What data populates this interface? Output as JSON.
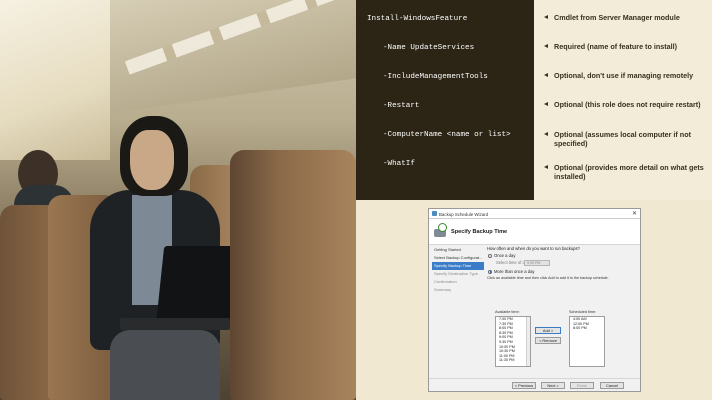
{
  "code": {
    "lines": [
      "Install-WindowsFeature",
      "-Name UpdateServices",
      "-IncludeManagementTools",
      "-Restart",
      "-ComputerName <name or list>",
      "-WhatIf"
    ]
  },
  "notes": [
    "Cmdlet from Server Manager module",
    "Required (name of feature to install)",
    "Optional, don't use if managing remotely",
    "Optional (this role does not require restart)",
    "Optional (assumes local computer if not specified)",
    "Optional (provides more detail on what gets installed)"
  ],
  "wizard": {
    "window_title": "Backup Schedule Wizard",
    "close_glyph": "✕",
    "page_title": "Specify Backup Time",
    "nav": [
      {
        "label": "Getting Started",
        "state": "normal"
      },
      {
        "label": "Select Backup Configurat...",
        "state": "normal"
      },
      {
        "label": "Specify Backup Time",
        "state": "active"
      },
      {
        "label": "Specify Destination Type",
        "state": "disabled"
      },
      {
        "label": "Confirmation",
        "state": "disabled"
      },
      {
        "label": "Summary",
        "state": "disabled"
      }
    ],
    "question": "How often and when do you want to run backups?",
    "option_once": "Once a day",
    "select_time_label": "Select time of day:",
    "select_time_value": "9:00 PM",
    "option_more": "More than once a day",
    "instructions": "Click an available time and then click Add to add it to the backup schedule.",
    "available_label": "Available time:",
    "scheduled_label": "Scheduled time:",
    "available_times": [
      "7:00 PM",
      "7:30 PM",
      "8:00 PM",
      "8:30 PM",
      "9:00 PM",
      "9:30 PM",
      "10:00 PM",
      "10:30 PM",
      "11:00 PM",
      "11:30 PM"
    ],
    "scheduled_times": [
      "4:00 AM",
      "12:00 PM",
      "8:00 PM"
    ],
    "add_button": "Add >",
    "remove_button": "< Remove",
    "previous_button": "< Previous",
    "next_button": "Next >",
    "finish_button": "Finish",
    "cancel_button": "Cancel"
  }
}
